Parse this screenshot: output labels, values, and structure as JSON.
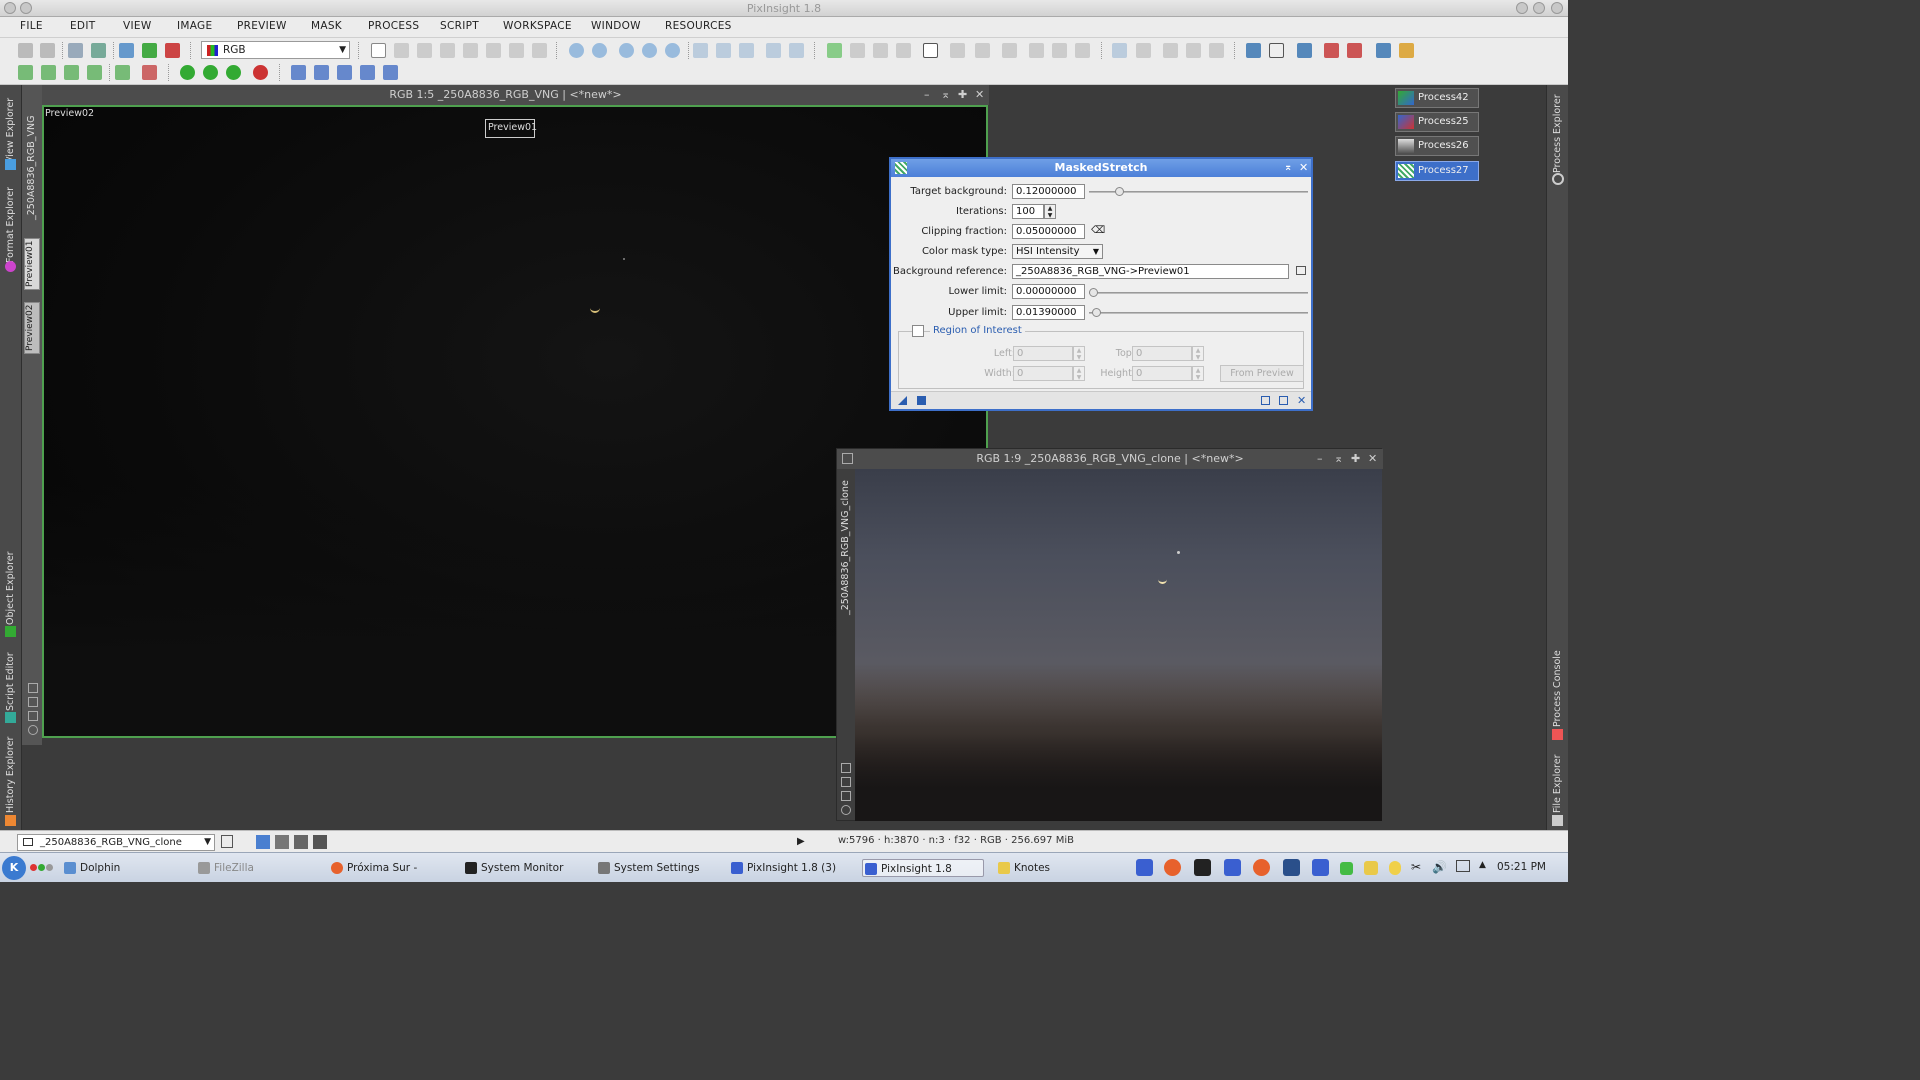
{
  "app": {
    "title": "PixInsight 1.8"
  },
  "menu": [
    "FILE",
    "EDIT",
    "VIEW",
    "IMAGE",
    "PREVIEW",
    "MASK",
    "PROCESS",
    "SCRIPT",
    "WORKSPACE",
    "WINDOW",
    "RESOURCES"
  ],
  "toolbar": {
    "color_mode": "RGB"
  },
  "left_dock": {
    "tabs": [
      "View Explorer",
      "Format Explorer",
      "Object Explorer",
      "Script Editor",
      "History Explorer"
    ]
  },
  "right_dock": {
    "tabs": [
      "Process Explorer",
      "Process Console",
      "File Explorer"
    ]
  },
  "main_window": {
    "title": "RGB 1:5 _250A8836_RGB_VNG | <*new*>",
    "side_tabs": [
      "_250A8836_RGB_VNG",
      "Preview01",
      "Preview02"
    ],
    "preview02_label": "Preview02",
    "preview01_label": "Preview01"
  },
  "clone_window": {
    "title": "RGB 1:9 _250A8836_RGB_VNG_clone | <*new*>",
    "side_tab": "_250A8836_RGB_VNG_clone"
  },
  "masked_stretch": {
    "title": "MaskedStretch",
    "target_background_label": "Target background:",
    "target_background": "0.12000000",
    "iterations_label": "Iterations:",
    "iterations": "100",
    "clipping_fraction_label": "Clipping fraction:",
    "clipping_fraction": "0.05000000",
    "color_mask_type_label": "Color mask type:",
    "color_mask_type": "HSI Intensity",
    "background_reference_label": "Background reference:",
    "background_reference": "_250A8836_RGB_VNG->Preview01",
    "lower_limit_label": "Lower limit:",
    "lower_limit": "0.00000000",
    "upper_limit_label": "Upper limit:",
    "upper_limit": "0.01390000",
    "roi_label": "Region of Interest",
    "roi": {
      "left_label": "Left:",
      "left": "0",
      "top_label": "Top:",
      "top": "0",
      "width_label": "Width:",
      "width": "0",
      "height_label": "Height:",
      "height": "0",
      "from_preview": "From Preview"
    }
  },
  "process_icons": [
    "Process42",
    "Process25",
    "Process26",
    "Process27"
  ],
  "statusbar": {
    "view": "_250A8836_RGB_VNG_clone",
    "info": "w:5796 · h:3870 · n:3 · f32 · RGB · 256.697 MiB"
  },
  "taskbar": {
    "tasks": [
      "Dolphin",
      "FileZilla",
      "Próxima Sur - Mozilla F",
      "System Monitor",
      "System Settings",
      "PixInsight 1.8 (3)",
      "PixInsight 1.8",
      "Knotes"
    ],
    "clock": "05:21 PM"
  }
}
